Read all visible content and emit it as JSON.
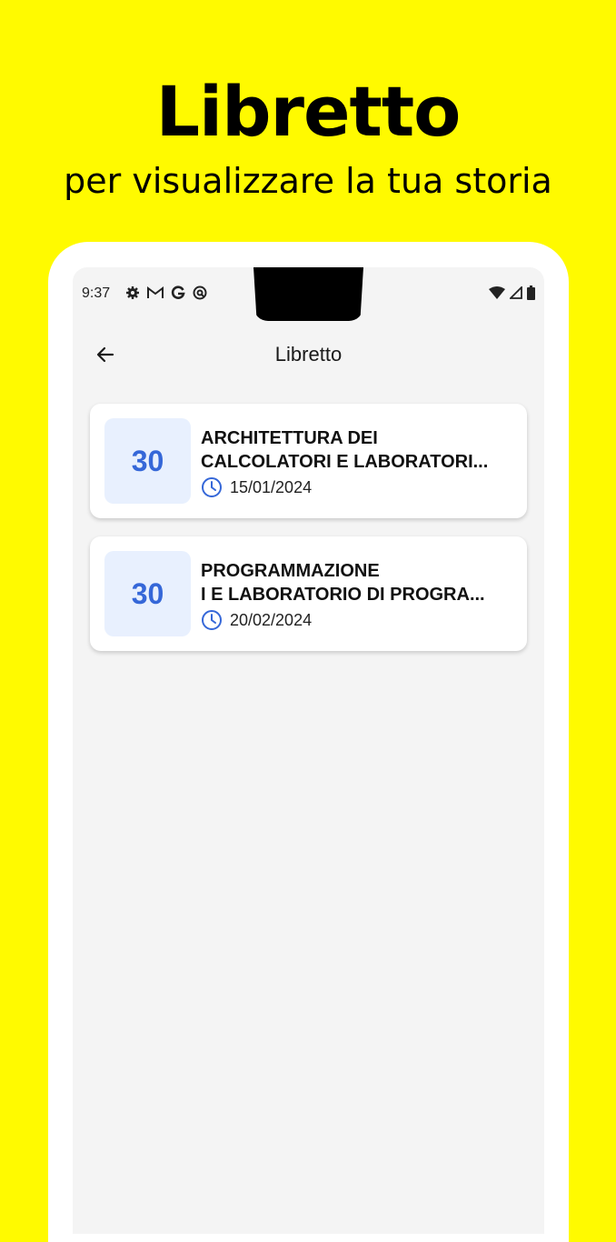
{
  "promo": {
    "title": "Libretto",
    "subtitle": "per visualizzare la tua storia"
  },
  "status_bar": {
    "time": "9:37",
    "left_icons": [
      "settings-icon",
      "gmail-icon",
      "google-icon",
      "vpn-icon"
    ],
    "right_icons": [
      "wifi-icon",
      "signal-icon",
      "battery-icon"
    ]
  },
  "app_bar": {
    "back_icon": "arrow-left-icon",
    "title": "Libretto"
  },
  "exams": [
    {
      "grade": "30",
      "course_line1": "ARCHITETTURA DEI",
      "course_line2": "CALCOLATORI E LABORATORI...",
      "date": "15/01/2024"
    },
    {
      "grade": "30",
      "course_line1": "PROGRAMMAZIONE",
      "course_line2": "I E LABORATORIO DI PROGRA...",
      "date": "20/02/2024"
    }
  ],
  "colors": {
    "background": "#FFFA00",
    "accent": "#3567D8",
    "grade_box": "#E8F0FE"
  }
}
